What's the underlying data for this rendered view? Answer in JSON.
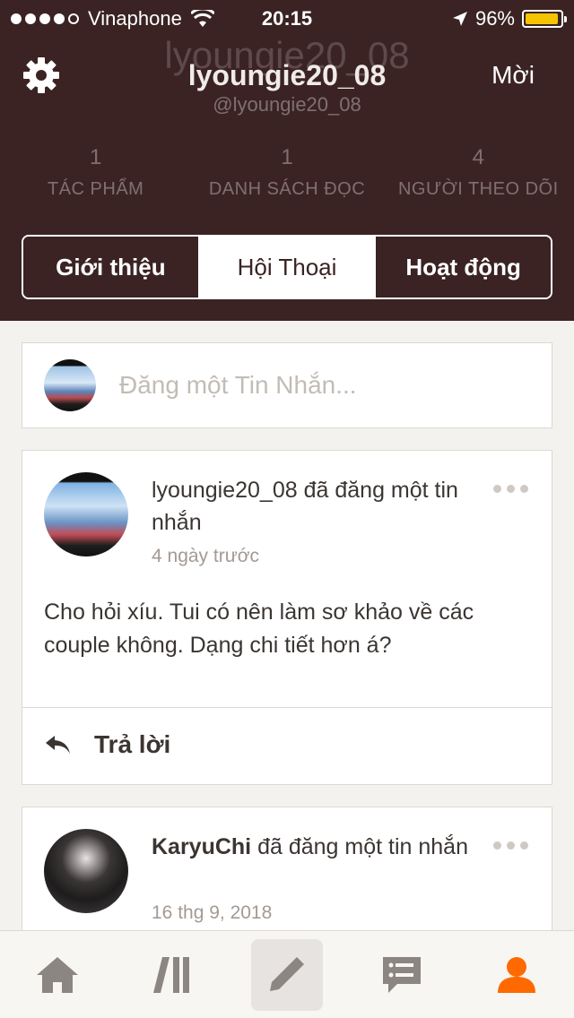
{
  "status_bar": {
    "carrier": "Vinaphone",
    "time": "20:15",
    "battery": "96%",
    "battery_level": 0.96
  },
  "profile": {
    "username": "lyoungie20_08",
    "handle": "@lyoungie20_08",
    "invite_label": "Mời",
    "stats": [
      {
        "value": "1",
        "label": "TÁC PHẨM"
      },
      {
        "value": "1",
        "label": "DANH SÁCH ĐỌC"
      },
      {
        "value": "4",
        "label": "NGƯỜI THEO DÕI"
      }
    ]
  },
  "tabs": [
    {
      "label": "Giới thiệu",
      "active": false
    },
    {
      "label": "Hội Thoại",
      "active": true
    },
    {
      "label": "Hoạt động",
      "active": false
    }
  ],
  "compose": {
    "placeholder": "Đăng một Tin Nhắn..."
  },
  "posts": [
    {
      "author": "lyoungie20_08",
      "action": " đã đăng một tin nhắn",
      "time": "4 ngày trước",
      "body": "Cho hỏi xíu. Tui có nên làm sơ khảo về các couple không. Dạng chi tiết hơn á?",
      "reply_label": "Trả lời"
    },
    {
      "author": "KaryuChi",
      "action": " đã đăng một tin nhắn",
      "time": "16 thg 9, 2018"
    }
  ],
  "bottom_nav": [
    "home-icon",
    "library-icon",
    "write-icon",
    "messages-icon",
    "profile-icon"
  ],
  "colors": {
    "header_bg": "#3b2323",
    "accent": "#ff6a00",
    "battery": "#f5c400"
  }
}
